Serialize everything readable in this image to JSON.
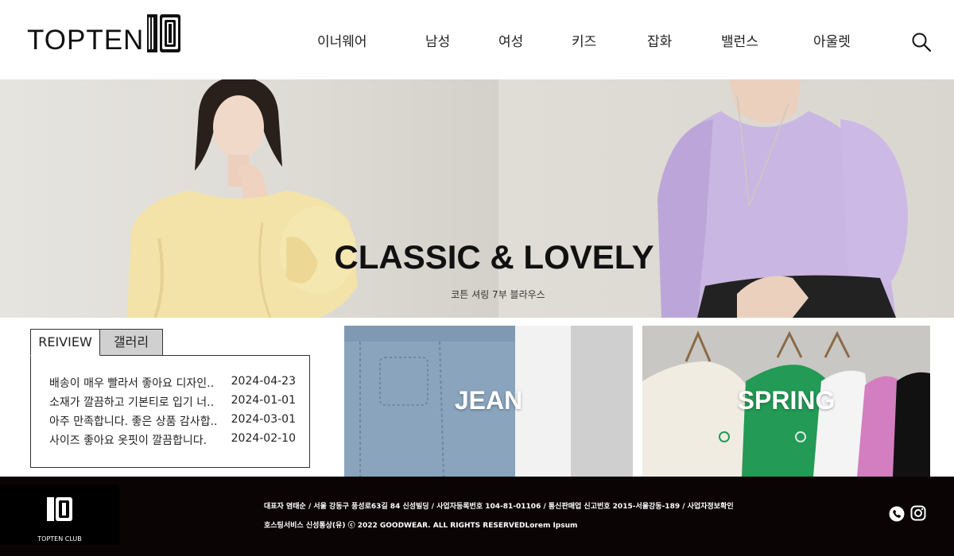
{
  "brand": {
    "name": "TOPTEN",
    "mark": "10"
  },
  "nav": {
    "items": [
      "이너웨어",
      "남성",
      "여성",
      "키즈",
      "잡화",
      "밸런스",
      "아울렛"
    ]
  },
  "hero": {
    "title": "CLASSIC & LOVELY",
    "subtitle": "코튼 셔링 7부 블라우스"
  },
  "review": {
    "tabs": [
      "REIVIEW",
      "갤러리"
    ],
    "items": [
      {
        "text": "배송이 매우 빨라서 좋아요 디자인..",
        "date": "2024-04-23"
      },
      {
        "text": "소재가 깔끔하고 기본티로 입기 너..",
        "date": "2024-01-01"
      },
      {
        "text": "아주 만족합니다. 좋은 상품 감사합..",
        "date": "2024-03-01"
      },
      {
        "text": "사이즈 좋아요 옷핏이 깔끔합니다.",
        "date": "2024-02-10"
      }
    ]
  },
  "cards": {
    "jean": "JEAN",
    "spring": "SPRING"
  },
  "footer": {
    "logo_mark": "10",
    "logo_text": "TOPTEN CLUB",
    "line1": "대표자 염태순  /  서울 강동구 풍성로63길 84 신성빌딩  /  사업자등록번호 104-81-01106  /  통신판매업 신고번호 2015-서울강동-189  /  사업자정보확인",
    "line2": "호스팅서비스 신성통상(유) ⓒ 2022 GOODWEAR. ALL RIGHTS RESERVEDLorem Ipsum"
  },
  "icons": {
    "search": "search-icon",
    "phone": "phone-icon",
    "instagram": "instagram-icon"
  },
  "colors": {
    "footer_bg": "#0a0405",
    "tab_inactive": "#d0d0d0"
  }
}
